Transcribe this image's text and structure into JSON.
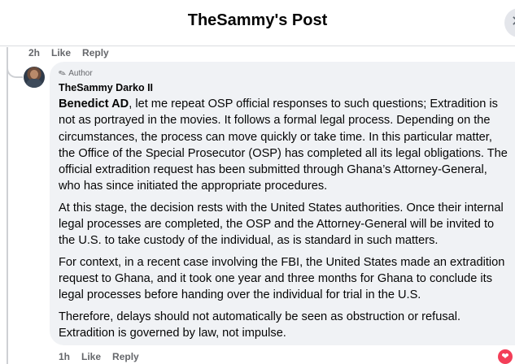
{
  "header": {
    "title": "TheSammy's Post",
    "close_label": "✕"
  },
  "top_meta": {
    "time": "2h",
    "like": "Like",
    "reply": "Reply"
  },
  "comment": {
    "author_badge": "Author",
    "name": "TheSammy Darko II",
    "mention": "Benedict AD",
    "paragraphs": [
      ", let me repeat OSP official responses to such questions; Extradition is not as portrayed in the movies. It follows a formal legal process. Depending on the circumstances, the process can move quickly or take time. In this particular matter, the Office of the Special Prosecutor (OSP) has completed all its legal obligations. The official extradition request has been submitted through Ghana’s Attorney-General, who has since initiated the appropriate procedures.",
      "At this stage, the decision rests with the United States authorities. Once their internal legal processes are completed, the OSP and the Attorney-General will be invited to the U.S. to take custody of the individual, as is standard in such matters.",
      "For context, in a recent case involving the FBI, the United States made an extradition request to Ghana, and it took one year and three months for Ghana to conclude its legal processes before handing over the individual for trial in the U.S.",
      "Therefore, delays should not automatically be seen as obstruction or refusal. Extradition is governed by law, not impulse."
    ],
    "meta": {
      "time": "1h",
      "like": "Like",
      "reply": "Reply"
    }
  },
  "icons": {
    "author": "pen-icon",
    "reaction": "heart-icon"
  },
  "colors": {
    "bubble": "#f0f2f5",
    "meta": "#65676b",
    "reaction": "#f33e58"
  }
}
